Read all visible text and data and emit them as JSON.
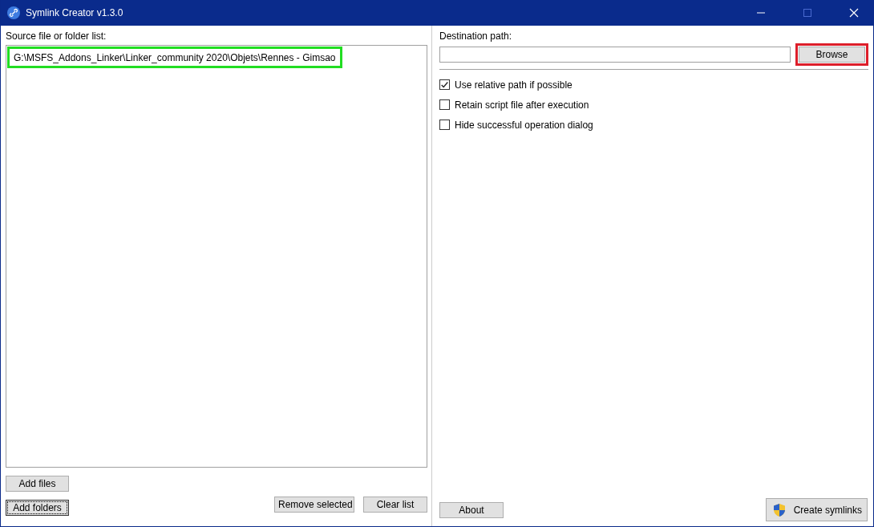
{
  "window": {
    "title": "Symlink Creator v1.3.0"
  },
  "source": {
    "label": "Source file or folder list:",
    "items": [
      {
        "path": "G:\\MSFS_Addons_Linker\\Linker_community 2020\\Objets\\Rennes - Gimsao",
        "highlighted": true
      }
    ]
  },
  "left_buttons": [
    {
      "label": "Add files",
      "focused": false
    },
    {
      "label": "Add folders",
      "focused": true
    }
  ],
  "list_buttons": [
    {
      "label": "Remove selected"
    },
    {
      "label": "Clear list"
    }
  ],
  "destination": {
    "label": "Destination path:",
    "browse": {
      "label": "Browse",
      "highlighted": true
    }
  },
  "options": [
    {
      "label": "Use relative path if possible",
      "checked": true
    },
    {
      "label": "Retain script file after execution",
      "checked": false
    },
    {
      "label": "Hide successful operation dialog",
      "checked": false
    }
  ],
  "about_button": "About",
  "create_button": "Create symlinks"
}
